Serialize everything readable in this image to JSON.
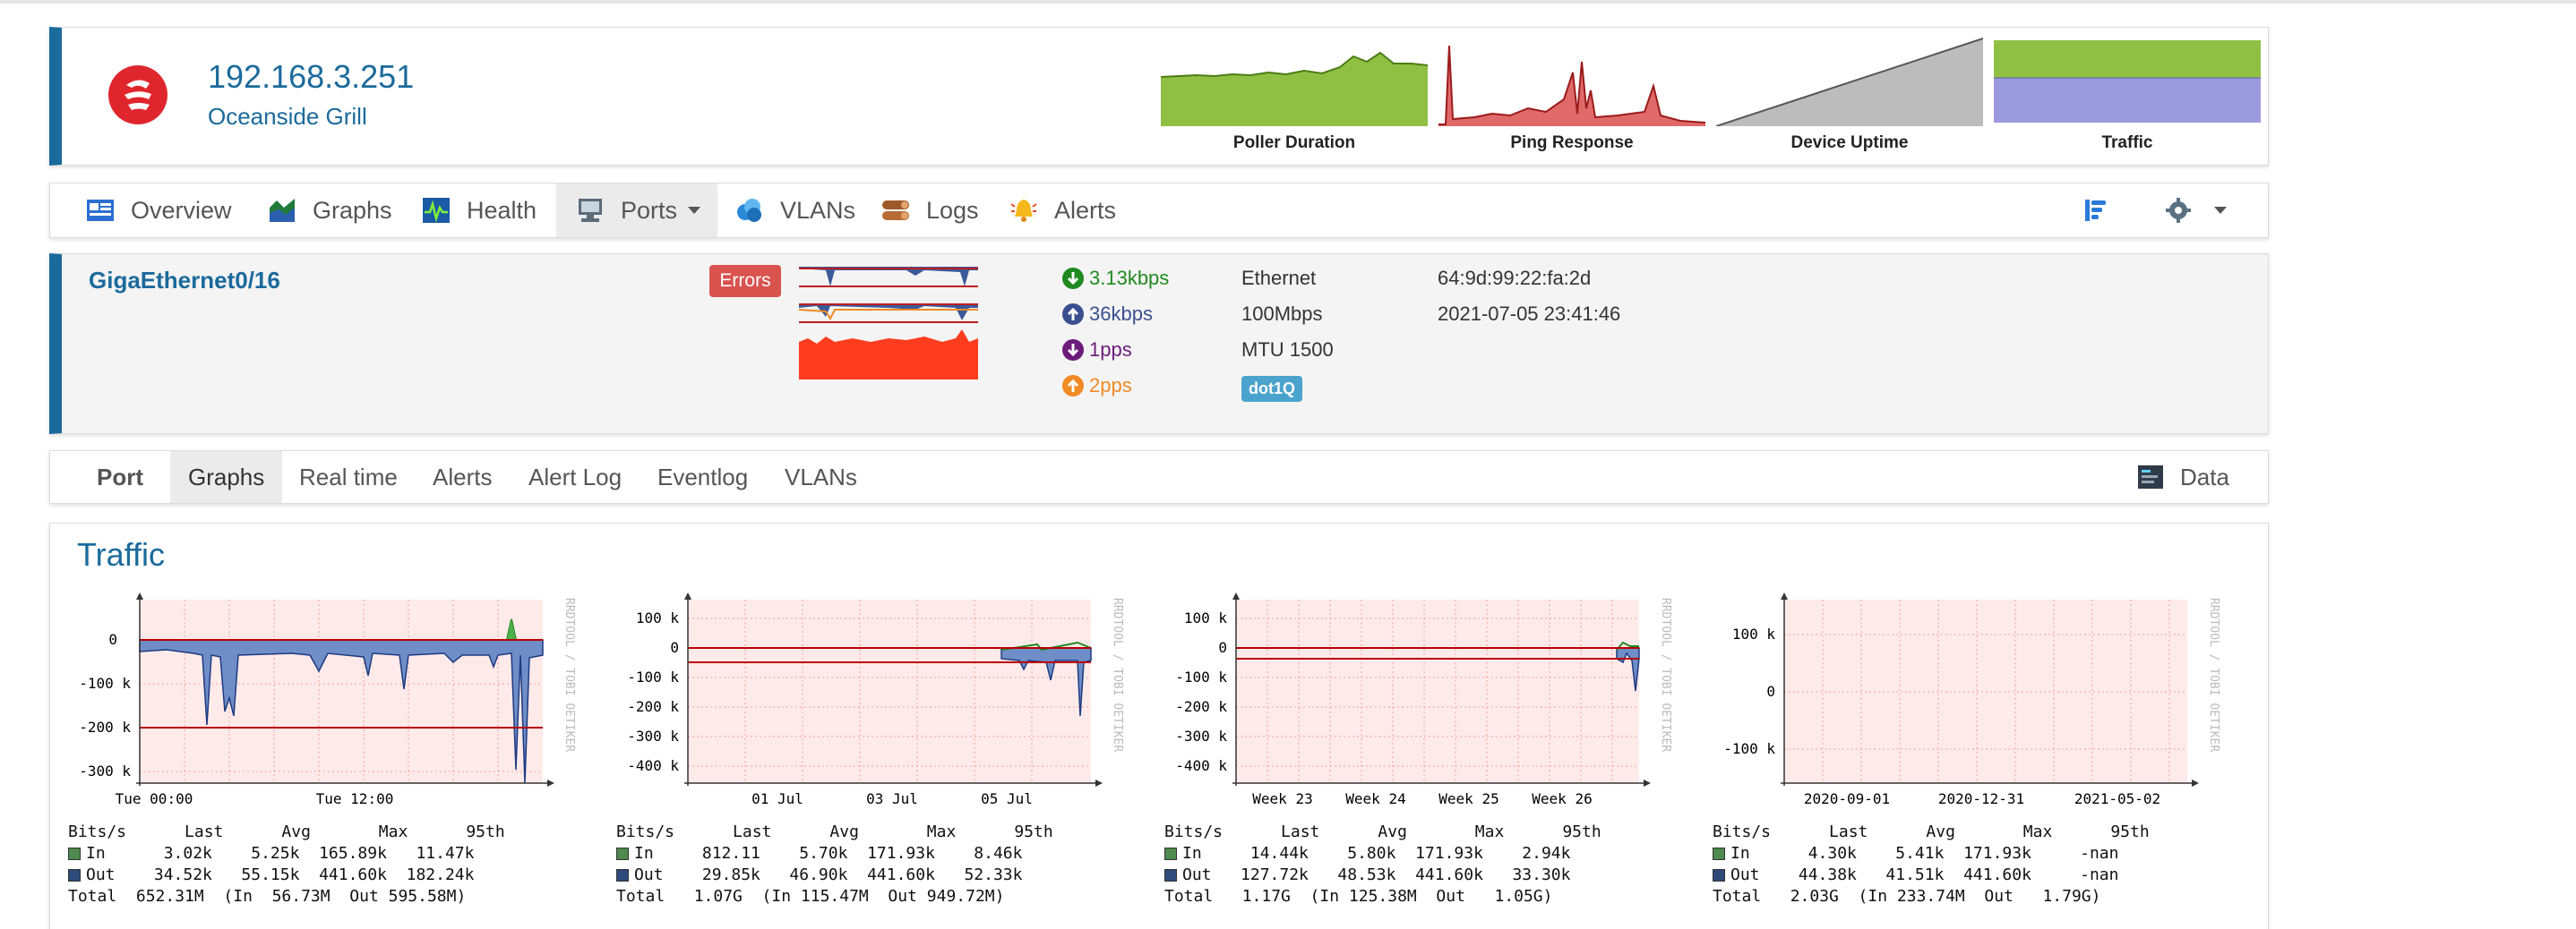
{
  "device": {
    "ip": "192.168.3.251",
    "name": "Oceanside Grill",
    "mini_graphs": [
      {
        "label": "Poller Duration",
        "color": "#8fc044"
      },
      {
        "label": "Ping Response",
        "color": "#c0302e"
      },
      {
        "label": "Device Uptime",
        "color": "#b0b0b0"
      },
      {
        "label": "Traffic",
        "color": "#8fc044"
      }
    ]
  },
  "nav": {
    "items": [
      {
        "label": "Overview",
        "icon": "overview-icon"
      },
      {
        "label": "Graphs",
        "icon": "graphs-icon"
      },
      {
        "label": "Health",
        "icon": "health-icon"
      },
      {
        "label": "Ports",
        "icon": "ports-icon",
        "active": true
      },
      {
        "label": "VLANs",
        "icon": "vlans-icon"
      },
      {
        "label": "Logs",
        "icon": "logs-icon"
      },
      {
        "label": "Alerts",
        "icon": "alerts-icon"
      }
    ],
    "right_icons": [
      "list-icon",
      "gear-icon"
    ]
  },
  "port": {
    "name": "GigaEthernet0/16",
    "errors_badge": "Errors",
    "in_rate": "3.13kbps",
    "out_rate": "36kbps",
    "in_pps": "1pps",
    "out_pps": "2pps",
    "type": "Ethernet",
    "speed": "100Mbps",
    "mtu": "MTU 1500",
    "vlan_tag": "dot1Q",
    "mac": "64:9d:99:22:fa:2d",
    "last_change": "2021-07-05 23:41:46",
    "colors": {
      "in": "#1f8a1f",
      "out": "#3a4f8f",
      "in_pps": "#6b1b7a",
      "out_pps": "#f08a24"
    }
  },
  "subnav": {
    "brand": "Port",
    "items": [
      "Graphs",
      "Real time",
      "Alerts",
      "Alert Log",
      "Eventlog",
      "VLANs"
    ],
    "active": "Graphs",
    "data_label": "Data"
  },
  "traffic": {
    "title": "Traffic",
    "watermark": "RRDTOOL / TOBI OETIKER",
    "graphs": [
      {
        "yticks": [
          "0",
          "-100 k",
          "-200 k",
          "-300 k"
        ],
        "xticks": [
          "Tue 00:00",
          "Tue 12:00"
        ],
        "legend": {
          "header": "Bits/s      Last      Avg       Max      95th",
          "in": "In      3.02k    5.25k  165.89k   11.47k",
          "out": "Out    34.52k   55.15k  441.60k  182.24k",
          "total": "Total  652.31M  (In  56.73M  Out 595.58M)"
        }
      },
      {
        "yticks": [
          "100 k",
          "0",
          "-100 k",
          "-200 k",
          "-300 k",
          "-400 k"
        ],
        "xticks": [
          "01 Jul",
          "03 Jul",
          "05 Jul"
        ],
        "legend": {
          "header": "Bits/s      Last      Avg       Max      95th",
          "in": "In     812.11    5.70k  171.93k    8.46k",
          "out": "Out    29.85k   46.90k  441.60k   52.33k",
          "total": "Total   1.07G  (In 115.47M  Out 949.72M)"
        }
      },
      {
        "yticks": [
          "100 k",
          "0",
          "-100 k",
          "-200 k",
          "-300 k",
          "-400 k"
        ],
        "xticks": [
          "Week 23",
          "Week 24",
          "Week 25",
          "Week 26"
        ],
        "legend": {
          "header": "Bits/s      Last      Avg       Max      95th",
          "in": "In     14.44k    5.80k  171.93k    2.94k",
          "out": "Out   127.72k   48.53k  441.60k   33.30k",
          "total": "Total   1.17G  (In 125.38M  Out   1.05G)"
        }
      },
      {
        "yticks": [
          "100 k",
          "0",
          "-100 k"
        ],
        "xticks": [
          "2020-09-01",
          "2020-12-31",
          "2021-05-02"
        ],
        "legend": {
          "header": "Bits/s      Last      Avg       Max      95th",
          "in": "In      4.30k    5.41k  171.93k     -nan",
          "out": "Out    44.38k   41.51k  441.60k     -nan",
          "total": "Total   2.03G  (In 233.74M  Out   1.79G)"
        }
      }
    ]
  }
}
